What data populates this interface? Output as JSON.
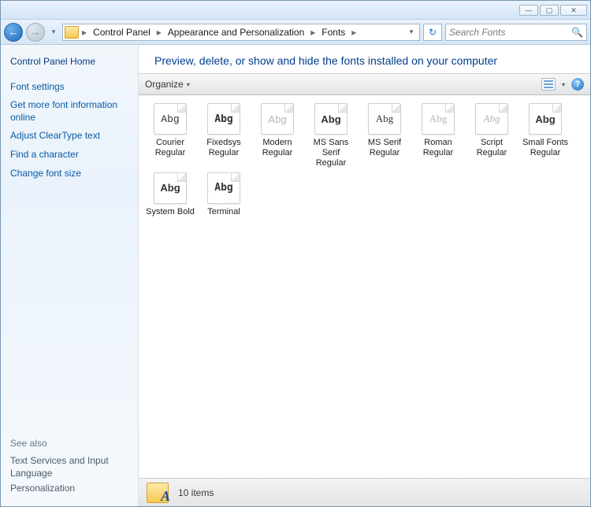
{
  "titlebar": {
    "min": "—",
    "max": "▢",
    "close": "✕"
  },
  "nav": {
    "back_glyph": "←",
    "fwd_glyph": "→",
    "dropdown_glyph": "▾",
    "refresh_glyph": "↻"
  },
  "breadcrumb": {
    "sep": "▸",
    "items": [
      "Control Panel",
      "Appearance and Personalization",
      "Fonts"
    ]
  },
  "search": {
    "placeholder": "Search Fonts",
    "icon": "🔍"
  },
  "sidebar": {
    "home": "Control Panel Home",
    "links": [
      "Font settings",
      "Get more font information online",
      "Adjust ClearType text",
      "Find a character",
      "Change font size"
    ],
    "see_also_header": "See also",
    "see_also": [
      "Text Services and Input Language",
      "Personalization"
    ]
  },
  "heading": "Preview, delete, or show and hide the fonts installed on your computer",
  "toolbar": {
    "organize": "Organize",
    "organize_dd": "▾",
    "help": "?"
  },
  "fonts": [
    {
      "name": "Courier Regular",
      "sample": "Abg",
      "style": "font-family:'Courier New',monospace;",
      "dimmed": false
    },
    {
      "name": "Fixedsys Regular",
      "sample": "Abg",
      "style": "font-family:monospace;font-weight:bold;",
      "dimmed": false
    },
    {
      "name": "Modern Regular",
      "sample": "Abg",
      "style": "font-family:Arial,sans-serif;",
      "dimmed": true
    },
    {
      "name": "MS Sans Serif Regular",
      "sample": "Abg",
      "style": "font-family:Arial,sans-serif;font-weight:bold;",
      "dimmed": false
    },
    {
      "name": "MS Serif Regular",
      "sample": "Abg",
      "style": "font-family:'Times New Roman',serif;",
      "dimmed": false
    },
    {
      "name": "Roman Regular",
      "sample": "Abg",
      "style": "font-family:'Times New Roman',serif;",
      "dimmed": true
    },
    {
      "name": "Script Regular",
      "sample": "Abg",
      "style": "font-family:cursive;font-style:italic;",
      "dimmed": true
    },
    {
      "name": "Small Fonts Regular",
      "sample": "Abg",
      "style": "font-family:Arial,sans-serif;font-weight:bold;",
      "dimmed": false
    },
    {
      "name": "System Bold",
      "sample": "Abg",
      "style": "font-family:Arial,sans-serif;font-weight:bold;",
      "dimmed": false
    },
    {
      "name": "Terminal",
      "sample": "Abg",
      "style": "font-family:monospace;font-weight:bold;",
      "dimmed": false
    }
  ],
  "status": {
    "count_text": "10 items"
  }
}
